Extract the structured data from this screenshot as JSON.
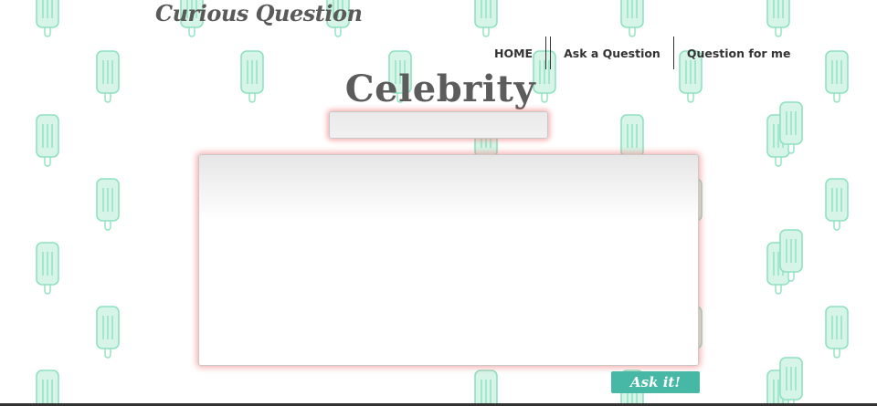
{
  "site": {
    "title": "Curious Question"
  },
  "nav": {
    "items": [
      {
        "label": "HOME"
      },
      {
        "label": "Ask a Question"
      },
      {
        "label": "Question for me"
      }
    ]
  },
  "page": {
    "category_title": "Celebrity"
  },
  "form": {
    "title_input_value": "",
    "question_value": "",
    "submit_label": "Ask it!"
  },
  "theme": {
    "accent": "#47b8a5",
    "input_glow": "#f06e6e",
    "pattern_icon": "popsicle-icon",
    "pattern_color": "#8ee2bf"
  }
}
